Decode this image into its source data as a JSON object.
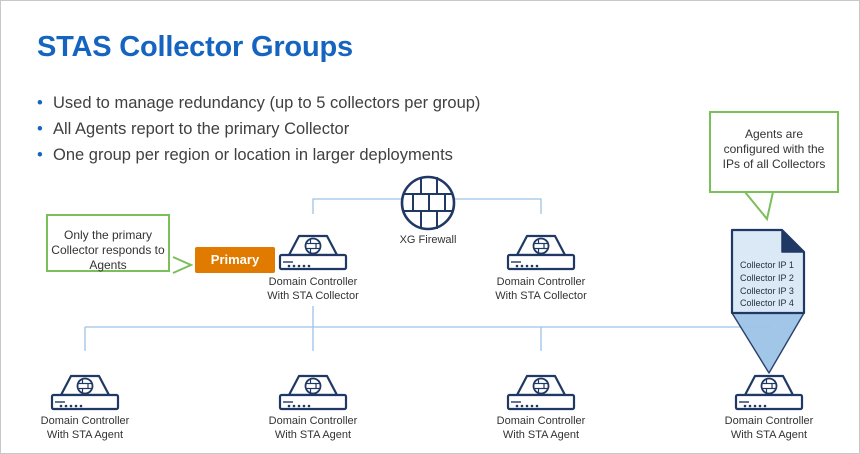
{
  "title": "STAS Collector Groups",
  "bullets": [
    "Used to manage redundancy (up to 5 collectors per group)",
    "All Agents report to the primary Collector",
    "One group per region or location in larger deployments"
  ],
  "firewall": {
    "label": "XG Firewall",
    "icon": "brick-wall-firewall-icon"
  },
  "primary_badge": "Primary",
  "callouts": {
    "primary": "Only the primary Collector responds to Agents",
    "agents": "Agents are configured with the IPs of all Collectors"
  },
  "collectors": [
    {
      "line1": "Domain Controller",
      "line2": "With STA Collector",
      "icon": "server-icon"
    },
    {
      "line1": "Domain Controller",
      "line2": "With STA Collector",
      "icon": "server-icon"
    }
  ],
  "agents": [
    {
      "line1": "Domain Controller",
      "line2": "With STA Agent",
      "icon": "server-icon"
    },
    {
      "line1": "Domain Controller",
      "line2": "With STA Agent",
      "icon": "server-icon"
    },
    {
      "line1": "Domain Controller",
      "line2": "With STA Agent",
      "icon": "server-icon"
    },
    {
      "line1": "Domain Controller",
      "line2": "With STA Agent",
      "icon": "server-icon"
    }
  ],
  "config_doc": {
    "icon": "document-icon",
    "lines": [
      "Collector IP 1",
      "Collector IP 2",
      "Collector IP 3",
      "Collector IP 4"
    ]
  },
  "colors": {
    "title": "#1565c0",
    "bullet": "#1565c0",
    "icon_dark": "#1f3864",
    "connector": "#9dc3e6",
    "primary_badge": "#e07b00",
    "callout_border": "#7bbf5a",
    "doc_fill": "#dbe9f6",
    "beam": "#9dc3e6"
  }
}
